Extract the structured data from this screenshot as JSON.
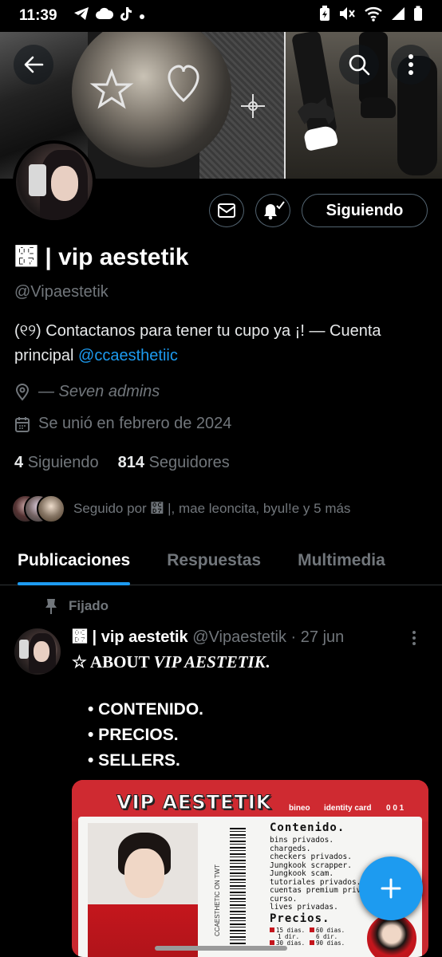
{
  "status_bar": {
    "time": "11:39",
    "left_icons": [
      "telegram-icon",
      "cloud-icon",
      "tiktok-icon",
      "dot-icon"
    ],
    "right_icons": [
      "battery-saver-icon",
      "mute-icon",
      "wifi-icon",
      "signal-icon",
      "battery-icon"
    ]
  },
  "profile": {
    "display_name": "೗ | vip aestetik",
    "handle": "@Vipaestetik",
    "bio_text": "(୧୨) Contactanos para tener tu cupo ya ¡!  — Cuenta principal ",
    "bio_link": "@ccaesthetiic",
    "location": "— Seven admins",
    "joined": "Se unió en febrero de 2024",
    "following_count": "4",
    "following_label": "Siguiendo",
    "followers_count": "814",
    "followers_label": "Seguidores",
    "followed_by": "Seguido por ೗ |, mae leoncita, byul!e y 5 más"
  },
  "actions": {
    "follow_button_label": "Siguiendo"
  },
  "tabs": [
    {
      "label": "Publicaciones",
      "active": true
    },
    {
      "label": "Respuestas",
      "active": false
    },
    {
      "label": "Multimedia",
      "active": false
    }
  ],
  "pinned_post": {
    "pinned_label": "Fijado",
    "author_name": "೗ | vip aestetik",
    "author_meta": "@Vipaestetik · 27 jun",
    "line1_prefix": "☆ ABOUT ",
    "line1_italic": "VIP AESTETIK",
    "line1_suffix": ".",
    "list": [
      "• CONTENIDO.",
      "• PRECIOS.",
      "• SELLERS."
    ],
    "card": {
      "title": "VIP AESTETIK",
      "tag1": "bineo",
      "tag2": "identity card",
      "tag3": "0 0 1",
      "barcode_text": "CCAESTHETIC ON TWT",
      "contenido_heading": "Contenido.",
      "contenido_items": [
        "bins privados.",
        "chargeds.",
        "checkers privados.",
        "Jungkook scrapper.",
        "Jungkook scam.",
        "tutoriales privados.",
        "cuentas premium privadas.",
        "curso.",
        "lives privadas."
      ],
      "precios_heading": "Precios.",
      "precios_items": [
        "15 dias.",
        "60 dias.",
        "1 dir.",
        "6 dir.",
        "30 dias.",
        "90 dias."
      ]
    }
  },
  "colors": {
    "accent": "#1d9bf0",
    "background": "#000000",
    "secondary_text": "#71767b",
    "card_red": "#cf2a31"
  }
}
